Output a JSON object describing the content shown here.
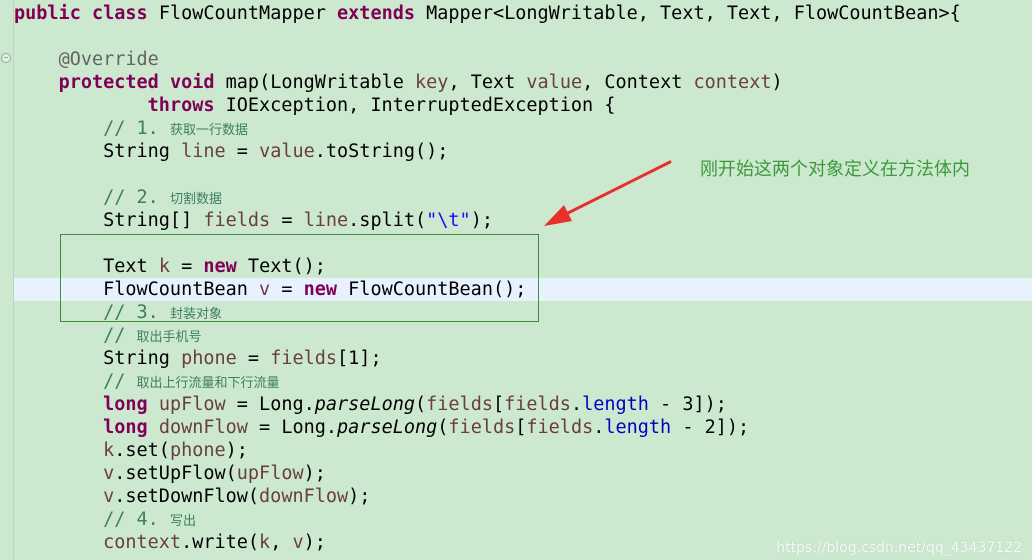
{
  "code": {
    "l1": {
      "kw1": "public",
      "kw2": "class",
      "cls": "FlowCountMapper",
      "kw3": "extends",
      "rest": "Mapper<LongWritable, Text, Text, FlowCountBean>{"
    },
    "l2": {
      "ann": "@Override"
    },
    "l3": {
      "kw1": "protected",
      "kw2": "void",
      "name": "map(LongWritable ",
      "p1": "key",
      ", Text ": ", Text ",
      "p2": "value",
      ", Context ": ", Context ",
      "p3": "context",
      ")": ")"
    },
    "l4": {
      "kw": "throws",
      "rest": " IOException, InterruptedException {"
    },
    "l5": {
      "prefix": "// 1. ",
      "cjk": "获取一行数据"
    },
    "l6": {
      "a": "String ",
      "v": "line",
      " = ": " = ",
      "v2": "value",
      ".toString();": ".toString();"
    },
    "l7": {
      "prefix": "// 2. ",
      "cjk": "切割数据"
    },
    "l8": {
      "a": "String[] ",
      "v": "fields",
      " = ": " = ",
      "v2": "line",
      ".split(": ".split(",
      "s": "\"\\t\"",
      ");": ");"
    },
    "l9": {
      "a": "Text ",
      "v": "k",
      " = ": " = ",
      "kw": "new",
      " Text();": " Text();"
    },
    "l10": {
      "a": "FlowCountBean ",
      "v": "v",
      " = ": " = ",
      "kw": "new",
      " FlowCountBean();": " FlowCountBean();"
    },
    "l11": {
      "prefix": "// 3. ",
      "cjk": "封装对象"
    },
    "l12": {
      "prefix": "// ",
      "cjk": "取出手机号"
    },
    "l13": {
      "a": "String ",
      "v": "phone",
      " = ": " = ",
      "v2": "fields",
      "[1];": "[1];"
    },
    "l14": {
      "prefix": "// ",
      "cjk": "取出上行流量和下行流量"
    },
    "l15": {
      "kw": "long",
      "sp": " ",
      "v": "upFlow",
      " = Long.": " = Long.",
      "m": "parseLong",
      "(": "(",
      "f1": "fields",
      "[": "[",
      "f2": "fields",
      ".": ".",
      "len": "length",
      " - 3]);": " - 3]);"
    },
    "l16": {
      "kw": "long",
      "sp": " ",
      "v": "downFlow",
      " = Long.": " = Long.",
      "m": "parseLong",
      "(": "(",
      "f1": "fields",
      "[": "[",
      "f2": "fields",
      ".": ".",
      "len": "length",
      " - 2]);": " - 2]);"
    },
    "l17": {
      "v": "k",
      ".set(": ".set(",
      "a": "phone",
      ");": ");"
    },
    "l18": {
      "v": "v",
      ".setUpFlow(": ".setUpFlow(",
      "a": "upFlow",
      ");": ");"
    },
    "l19": {
      "v": "v",
      ".setDownFlow(": ".setDownFlow(",
      "a": "downFlow",
      ");": ");"
    },
    "l20": {
      "prefix": "// 4. ",
      "cjk": "写出"
    },
    "l21": {
      "v": "context",
      ".write(": ".write(",
      "a": "k",
      ", ": ", ",
      "b": "v",
      ");": ");"
    }
  },
  "annotation": {
    "note": "刚开始这两个对象定义在方法体内"
  },
  "watermark": "https://blog.csdn.net/qq_43437122",
  "colors": {
    "background": "#cce8cf",
    "keyword": "#7f0055",
    "comment": "#3f7f5f",
    "field": "#0000c0",
    "string": "#2a00ff",
    "variable": "#6a3e3e",
    "arrow": "#e8302a",
    "note": "#3c9a3c",
    "box": "#3c8d3c",
    "current_line": "#e8f2fe"
  }
}
